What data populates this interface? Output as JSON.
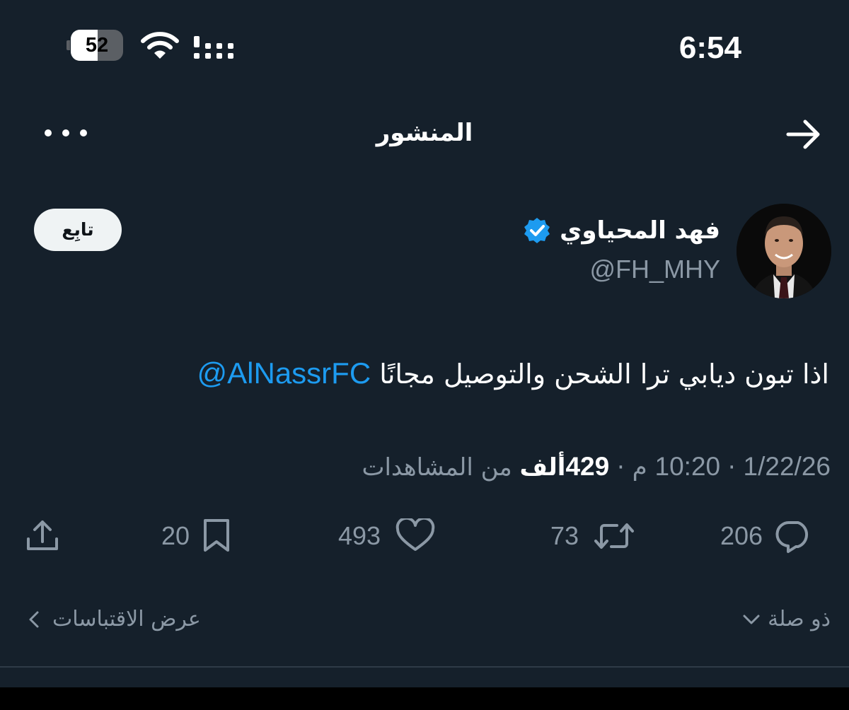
{
  "status_bar": {
    "battery_level": "52",
    "battery_fraction": 0.52,
    "time": "6:54"
  },
  "header": {
    "title": "المنشور",
    "back_icon": "arrow-right-icon",
    "more_icon": "more-horizontal-icon"
  },
  "author": {
    "name": "فهد المحياوي",
    "handle": "@FH_MHY",
    "verified": true,
    "follow_label": "تابِع"
  },
  "tweet": {
    "text": "اذا تبون ديابي ترا الشحن والتوصيل مجانًا",
    "mention": "@AlNassrFC"
  },
  "meta": {
    "date": "1/22/26",
    "separator": "·",
    "time": "10:20",
    "period": "م",
    "views_count": "429",
    "views_unit": "ألف",
    "views_label": "من المشاهدات"
  },
  "actions": {
    "replies": "206",
    "reposts": "73",
    "likes": "493",
    "bookmarks": "20"
  },
  "footer": {
    "sort_label": "ذو صلة",
    "quotes_label": "عرض الاقتباسات"
  },
  "colors": {
    "background": "#15202b",
    "accent": "#1d9bf0",
    "muted": "#8b98a5"
  }
}
